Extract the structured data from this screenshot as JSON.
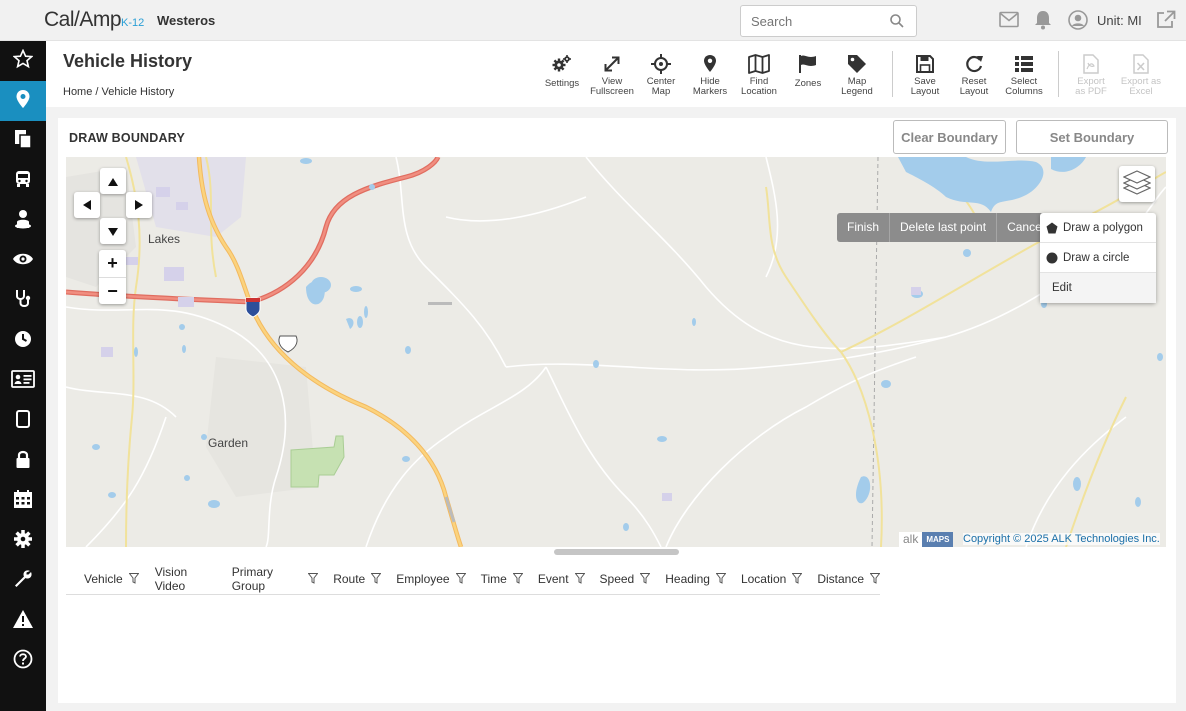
{
  "app": {
    "logo_main": "Cal/Amp",
    "logo_sub": "K-12",
    "tenant": "Westeros"
  },
  "topbar": {
    "search_placeholder": "Search",
    "unit_label": "Unit: MI",
    "icons": [
      "mail-icon",
      "bell-icon",
      "user-icon",
      "external-link-icon"
    ]
  },
  "sidebar": {
    "active_index": 1,
    "items": [
      {
        "icon": "star-icon"
      },
      {
        "icon": "map-pin-icon"
      },
      {
        "icon": "documents-icon"
      },
      {
        "icon": "bus-icon"
      },
      {
        "icon": "driver-icon"
      },
      {
        "icon": "eye-icon"
      },
      {
        "icon": "stethoscope-icon"
      },
      {
        "icon": "clock-icon"
      },
      {
        "icon": "id-card-icon"
      },
      {
        "icon": "tablet-icon"
      },
      {
        "icon": "lock-icon"
      },
      {
        "icon": "calendar-icon"
      },
      {
        "icon": "gear-icon"
      },
      {
        "icon": "wrench-icon"
      },
      {
        "icon": "warning-icon"
      },
      {
        "icon": "help-icon"
      }
    ]
  },
  "header": {
    "title": "Vehicle History",
    "breadcrumb": "Home / Vehicle History",
    "toolbar": [
      {
        "key": "settings",
        "label": "Settings",
        "icon": "gears-icon"
      },
      {
        "key": "fullscreen",
        "label": "View Fullscreen",
        "icon": "expand-icon"
      },
      {
        "key": "center",
        "label": "Center Map",
        "icon": "crosshair-icon"
      },
      {
        "key": "markers",
        "label": "Hide Markers",
        "icon": "marker-icon"
      },
      {
        "key": "find",
        "label": "Find Location",
        "icon": "map-icon"
      },
      {
        "key": "zones",
        "label": "Zones",
        "icon": "flag-icon"
      },
      {
        "key": "legend",
        "label": "Map Legend",
        "icon": "tag-icon"
      },
      {
        "key": "save",
        "label": "Save Layout",
        "icon": "floppy-icon"
      },
      {
        "key": "reset",
        "label": "Reset Layout",
        "icon": "refresh-icon"
      },
      {
        "key": "columns",
        "label": "Select Columns",
        "icon": "list-icon"
      },
      {
        "key": "pdf",
        "label": "Export as PDF",
        "icon": "pdf-file-icon"
      },
      {
        "key": "excel",
        "label": "Export as Excel",
        "icon": "excel-file-icon"
      }
    ]
  },
  "boundary": {
    "title": "DRAW BOUNDARY",
    "clear_label": "Clear Boundary",
    "set_label": "Set Boundary"
  },
  "map": {
    "labels": {
      "lakes": "Lakes",
      "garden": "Garden"
    },
    "draw_toolbar": {
      "finish": "Finish",
      "delete_last": "Delete last point",
      "cancel": "Cancel"
    },
    "draw_menu": {
      "polygon": "Draw a polygon",
      "circle": "Draw a circle",
      "edit": "Edit"
    },
    "attribution": {
      "logo": "alk",
      "maps": "MAPS",
      "copyright": "Copyright © 2025 ALK Technologies Inc."
    }
  },
  "table": {
    "columns": [
      "Vehicle",
      "Vision Video",
      "Primary Group",
      "Route",
      "Employee",
      "Time",
      "Event",
      "Speed",
      "Heading",
      "Location",
      "Distance"
    ]
  },
  "colors": {
    "accent": "#1a8fc0",
    "sidebar": "#111111",
    "highway": "#e8756a",
    "road": "#f7c86a",
    "water": "#a3cceb"
  }
}
